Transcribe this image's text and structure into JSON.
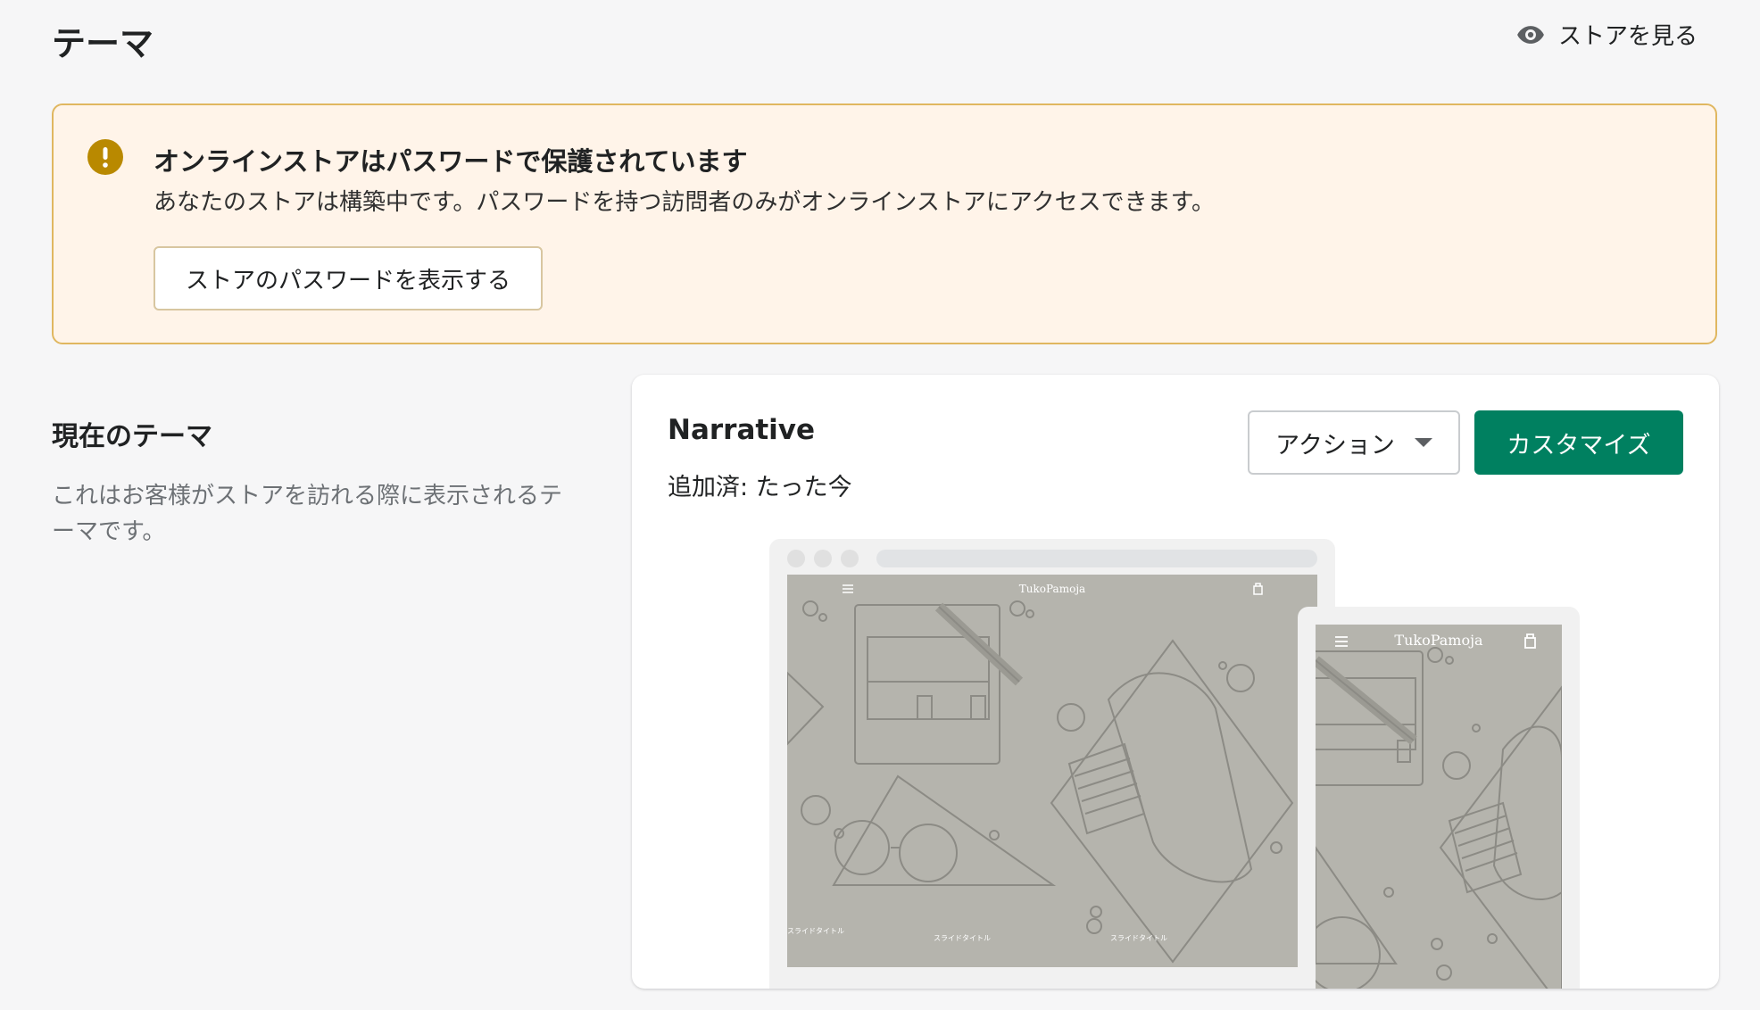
{
  "header": {
    "title": "テーマ",
    "view_store_label": "ストアを見る",
    "view_store_icon": "eye-icon"
  },
  "banner": {
    "icon": "alert-circle-icon",
    "icon_color": "#b98900",
    "title": "オンラインストアはパスワードで保護されています",
    "body": "あなたのストアは構築中です。パスワードを持つ訪問者のみがオンラインストアにアクセスできます。",
    "button_label": "ストアのパスワードを表示する"
  },
  "current_theme": {
    "section_title": "現在のテーマ",
    "section_description": "これはお客様がストアを訪れる際に表示されるテーマです。",
    "name": "Narrative",
    "added_label": "追加済: たった今",
    "actions_label": "アクション",
    "customize_label": "カスタマイズ",
    "customize_color": "#008060",
    "preview": {
      "shop_name": "TukoPamoja",
      "slide_label": "スライドタイトル"
    }
  }
}
